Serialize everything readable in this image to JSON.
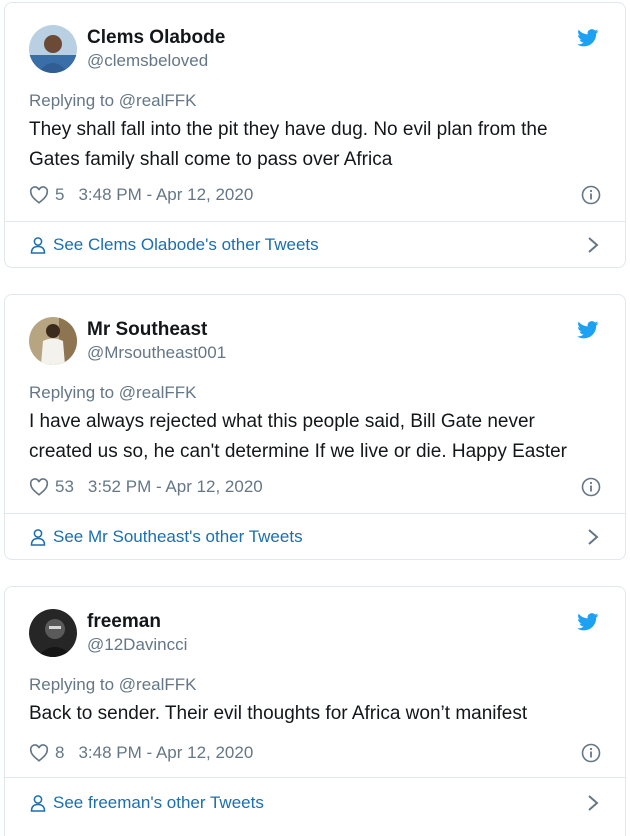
{
  "tweets": [
    {
      "name": "Clems Olabode",
      "handle": "@clemsbeloved",
      "replying_prefix": "Replying to",
      "replying_to": "@realFFK",
      "text_lines": [
        "They shall fall into the pit they have dug. No evil plan from the",
        "Gates family shall come to pass over Africa"
      ],
      "likes": "5",
      "timestamp": "3:48 PM - Apr 12, 2020",
      "see_more": "See Clems Olabode's other Tweets"
    },
    {
      "name": "Mr Southeast",
      "handle": "@Mrsoutheast001",
      "replying_prefix": "Replying to",
      "replying_to": "@realFFK",
      "text_lines": [
        "I have always rejected what this people said, Bill Gate never",
        "created us so, he can't determine If we live or die. Happy Easter"
      ],
      "likes": "53",
      "timestamp": "3:52 PM - Apr 12, 2020",
      "see_more": "See Mr Southeast's other Tweets"
    },
    {
      "name": "freeman",
      "handle": "@12Davincci",
      "replying_prefix": "Replying to",
      "replying_to": "@realFFK",
      "text_lines": [
        "Back to sender. Their evil thoughts for Africa won’t manifest"
      ],
      "likes": "8",
      "timestamp": "3:48 PM - Apr 12, 2020",
      "see_more": "See freeman's other Tweets"
    }
  ],
  "colors": {
    "twitter_blue": "#1da1f2",
    "link_blue": "#1b6eaf",
    "secondary_text": "#657786",
    "border": "#e1e8ed"
  },
  "icons": [
    "twitter-bird-icon",
    "heart-icon",
    "info-icon",
    "person-icon",
    "chevron-right-icon"
  ]
}
